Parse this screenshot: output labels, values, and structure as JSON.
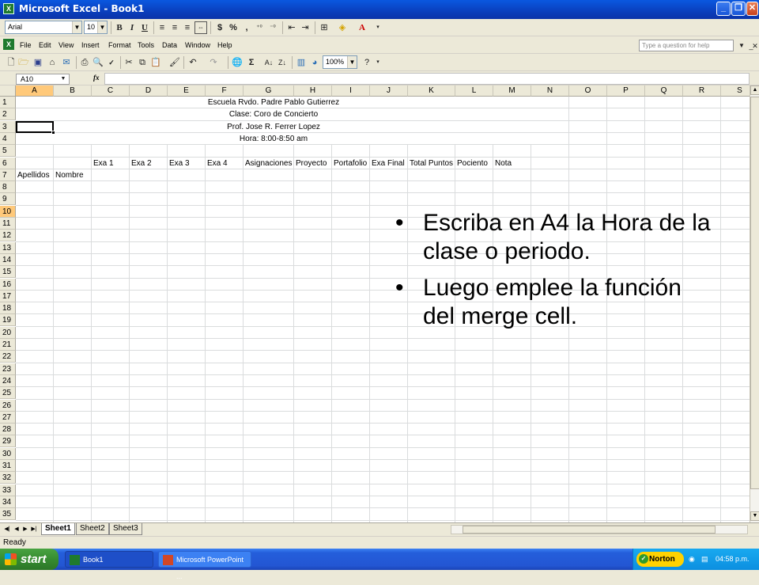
{
  "window": {
    "title": "Microsoft Excel - Book1",
    "controls": [
      "_",
      "❐",
      "✕"
    ]
  },
  "format_toolbar": {
    "font": "Arial",
    "size": "10",
    "bold": "B",
    "italic": "I",
    "underline": "U",
    "currency": "$",
    "percent": "%",
    "comma": ","
  },
  "menu": {
    "items": [
      "File",
      "Edit",
      "View",
      "Insert",
      "Format",
      "Tools",
      "Data",
      "Window",
      "Help"
    ],
    "help_placeholder": "Type a question for help",
    "zoom": "100%"
  },
  "formula_bar": {
    "name_box": "A10",
    "fx": "fx"
  },
  "grid": {
    "columns": [
      "A",
      "B",
      "C",
      "D",
      "E",
      "F",
      "G",
      "H",
      "I",
      "J",
      "K",
      "L",
      "M",
      "N",
      "O",
      "P",
      "Q",
      "R",
      "S"
    ],
    "rows": [
      "1",
      "2",
      "3",
      "4",
      "5",
      "6",
      "7",
      "8",
      "9",
      "10",
      "11",
      "12",
      "13",
      "14",
      "15",
      "16",
      "17",
      "18",
      "19",
      "20",
      "21",
      "22",
      "23",
      "24",
      "25",
      "26",
      "27",
      "28",
      "29",
      "30",
      "31",
      "32",
      "33",
      "34",
      "35"
    ],
    "merged_title_lines": [
      "Escuela Rvdo. Padre Pablo Gutierrez",
      "Clase: Coro de Concierto",
      "Prof. Jose R. Ferrer Lopez",
      "Hora: 8:00-8:50 am"
    ],
    "row6_headers": [
      "Exa 1",
      "Exa 2",
      "Exa 3",
      "Exa 4",
      "Asignaciones",
      "Proyecto",
      "Portafolio",
      "Exa Final",
      "Total Puntos",
      "Pociento",
      "Nota"
    ],
    "row7_headers": [
      "Apellidos",
      "Nombre"
    ],
    "active_row": "10",
    "active_col": "A"
  },
  "sheets": {
    "tabs": [
      "Sheet1",
      "Sheet2",
      "Sheet3"
    ],
    "active": "Sheet1"
  },
  "status": {
    "text": "Ready"
  },
  "taskbar": {
    "start": "start",
    "items": [
      "Book1",
      "Microsoft PowerPoint ..."
    ],
    "tray_app": "Norton",
    "clock": "04:58 p.m."
  },
  "slide_text": {
    "bullets": [
      "Escriba en A4 la Hora de la clase o periodo.",
      "Luego emplee la función del merge cell."
    ],
    "bullet_char": "•"
  },
  "colors": {
    "titlebar": "#0a3fbd",
    "selection_header": "#ffc97a",
    "start_button": "#368c31",
    "taskbar": "#245edb"
  }
}
